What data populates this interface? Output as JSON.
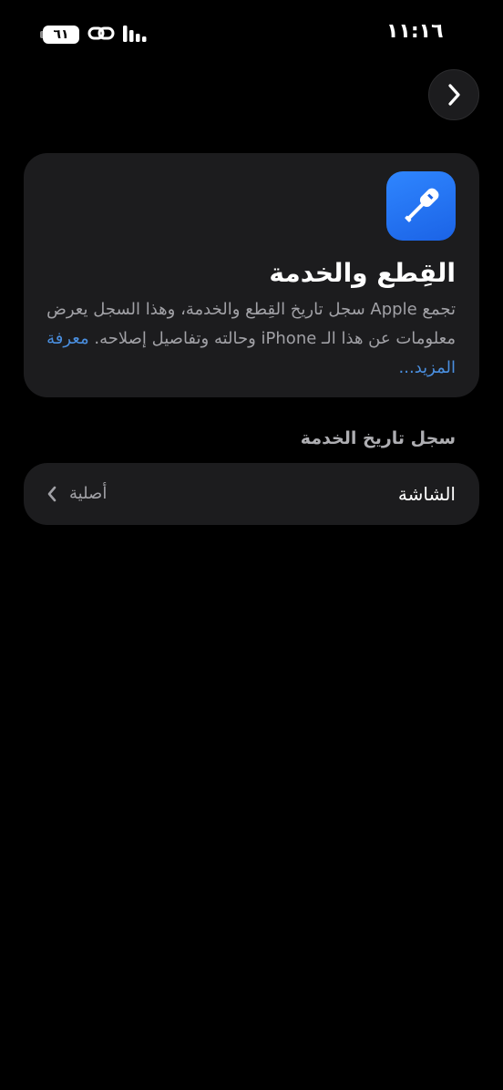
{
  "status_bar": {
    "time": "١١:١٦",
    "battery": "٦١",
    "icons": [
      "battery-icon",
      "link-icon",
      "signal-icon"
    ]
  },
  "nav": {
    "forward_icon": "chevron-right-icon"
  },
  "info_card": {
    "icon": "screwdriver-icon",
    "title": "القِطع والخدمة",
    "description": "تجمع Apple سجل تاريخ القِطع والخدمة، وهذا السجل يعرض معلومات عن هذا الـ iPhone وحالته وتفاصيل إصلاحه. ",
    "learn_more": "معرفة المزيد..."
  },
  "service_history": {
    "header": "سجل تاريخ الخدمة",
    "rows": [
      {
        "label": "الشاشة",
        "value": "أصلية"
      }
    ]
  },
  "colors": {
    "background": "#000000",
    "card": "#1c1c1e",
    "accent_link": "#4a8fe0",
    "icon_blue": "#2f86ff",
    "secondary_text": "#a1a1a6"
  }
}
